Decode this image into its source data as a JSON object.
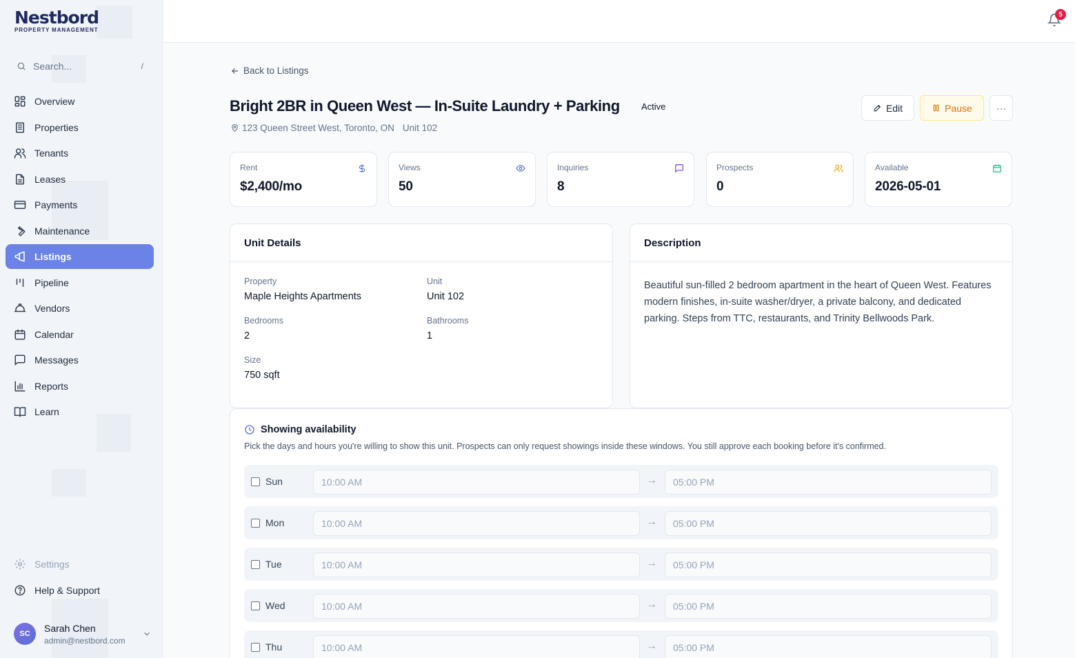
{
  "brand": {
    "name": "Nestbord",
    "tagline": "PROPERTY MANAGEMENT"
  },
  "search": {
    "placeholder": "Search...",
    "shortcut": "/"
  },
  "nav": [
    {
      "label": "Overview",
      "icon": "grid-icon"
    },
    {
      "label": "Properties",
      "icon": "building-icon"
    },
    {
      "label": "Tenants",
      "icon": "users-icon"
    },
    {
      "label": "Leases",
      "icon": "file-icon"
    },
    {
      "label": "Payments",
      "icon": "credit-card-icon"
    },
    {
      "label": "Maintenance",
      "icon": "wrench-icon"
    },
    {
      "label": "Listings",
      "icon": "megaphone-icon",
      "active": true
    },
    {
      "label": "Pipeline",
      "icon": "kanban-icon"
    },
    {
      "label": "Vendors",
      "icon": "hard-hat-icon"
    },
    {
      "label": "Calendar",
      "icon": "calendar-icon"
    },
    {
      "label": "Messages",
      "icon": "message-icon"
    },
    {
      "label": "Reports",
      "icon": "bar-chart-icon"
    },
    {
      "label": "Learn",
      "icon": "book-icon"
    }
  ],
  "nav_bottom": {
    "settings": "Settings",
    "help": "Help & Support"
  },
  "user": {
    "initials": "SC",
    "name": "Sarah Chen",
    "email": "admin@nestbord.com"
  },
  "notifications": {
    "count": "5"
  },
  "listing": {
    "back_label": "Back to Listings",
    "title": "Bright 2BR in Queen West — In-Suite Laundry + Parking",
    "status": "Active",
    "address": "123 Queen Street West, Toronto, ON",
    "unit": "Unit 102",
    "actions": {
      "edit": "Edit",
      "pause": "Pause",
      "more": "···"
    }
  },
  "stats": [
    {
      "label": "Rent",
      "value": "$2,400/mo",
      "icon": "dollar-icon",
      "color": "#4f6fd8"
    },
    {
      "label": "Views",
      "value": "50",
      "icon": "eye-icon",
      "color": "#4f6fd8"
    },
    {
      "label": "Inquiries",
      "value": "8",
      "icon": "message-icon",
      "color": "#7c3aed"
    },
    {
      "label": "Prospects",
      "value": "0",
      "icon": "users-icon",
      "color": "#f59e0b"
    },
    {
      "label": "Available",
      "value": "2026-05-01",
      "icon": "calendar-icon",
      "color": "#10b981"
    }
  ],
  "unit_details": {
    "title": "Unit Details",
    "fields": [
      {
        "label": "Property",
        "value": "Maple Heights Apartments"
      },
      {
        "label": "Unit",
        "value": "Unit 102"
      },
      {
        "label": "Bedrooms",
        "value": "2"
      },
      {
        "label": "Bathrooms",
        "value": "1"
      },
      {
        "label": "Size",
        "value": "750 sqft"
      }
    ]
  },
  "description": {
    "title": "Description",
    "text": "Beautiful sun-filled 2 bedroom apartment in the heart of Queen West. Features modern finishes, in-suite washer/dryer, a private balcony, and dedicated parking. Steps from TTC, restaurants, and Trinity Bellwoods Park."
  },
  "showing": {
    "title": "Showing availability",
    "subtitle": "Pick the days and hours you're willing to show this unit. Prospects can only request showings inside these windows. You still approve each booking before it's confirmed.",
    "arrow": "→",
    "days": [
      {
        "day": "Sun",
        "start": "10:00 AM",
        "end": "05:00 PM",
        "checked": false
      },
      {
        "day": "Mon",
        "start": "10:00 AM",
        "end": "05:00 PM",
        "checked": false
      },
      {
        "day": "Tue",
        "start": "10:00 AM",
        "end": "05:00 PM",
        "checked": false
      },
      {
        "day": "Wed",
        "start": "10:00 AM",
        "end": "05:00 PM",
        "checked": false
      },
      {
        "day": "Thu",
        "start": "10:00 AM",
        "end": "05:00 PM",
        "checked": false
      }
    ]
  },
  "colors": {
    "accent": "#6b82e6",
    "brand": "#1e2a5e",
    "badge": "#e11d48",
    "pause": "#d97706"
  }
}
